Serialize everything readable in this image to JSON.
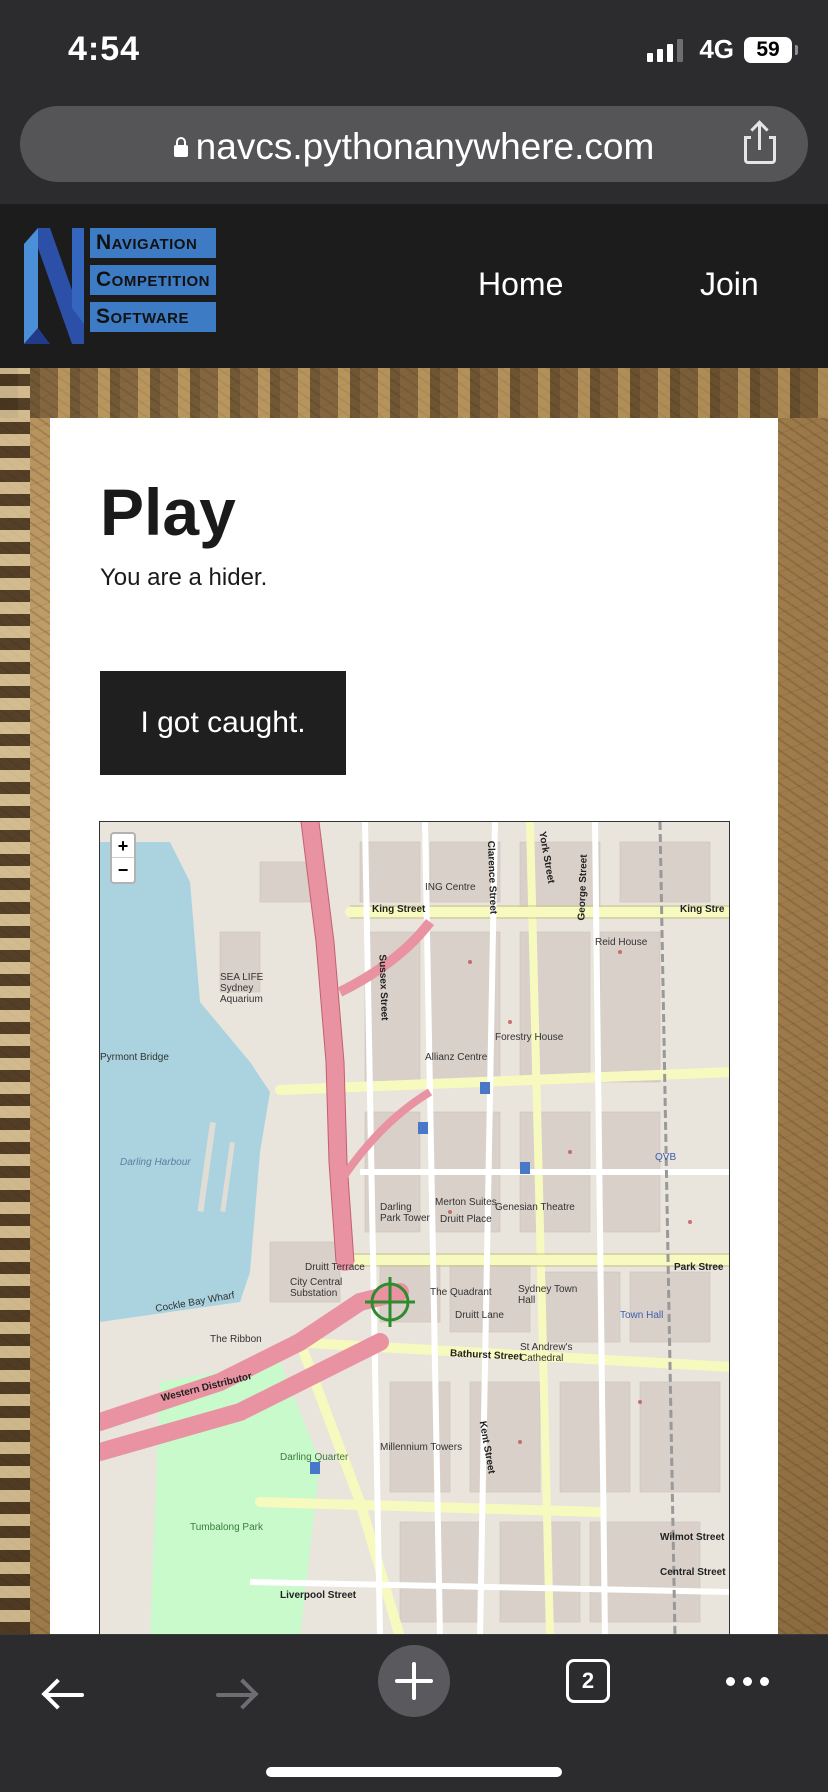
{
  "status": {
    "time": "4:54",
    "network": "4G",
    "battery": "59"
  },
  "browser": {
    "url": "navcs.pythonanywhere.com",
    "tab_count": "2"
  },
  "header": {
    "logo_lines": [
      "Navigation",
      "Competition",
      "Software"
    ],
    "nav": {
      "home": "Home",
      "join": "Join"
    }
  },
  "page": {
    "title": "Play",
    "role_text": "You are a hider.",
    "caught_button": "I got caught."
  },
  "map": {
    "zoom_in": "+",
    "zoom_out": "−",
    "labels": {
      "king_street": "King Street",
      "king_street_2": "King Stre",
      "bathurst_street": "Bathurst Street",
      "druitt_lane": "Druitt Lane",
      "druitt_place": "Druitt Place",
      "druitt_terrace": "Druitt Terrace",
      "park_street": "Park Stree",
      "liverpool_street": "Liverpool Street",
      "western_distributor": "Western Distributor",
      "the_ribbon": "The Ribbon",
      "the_quadrant": "The Quadrant",
      "city_central_substation": "City Central Substation",
      "darling_harbour": "Darling Harbour",
      "pyrmont_bridge": "Pyrmont Bridge",
      "sea_life": "SEA LIFE Sydney Aquarium",
      "sussex_street": "Sussex Street",
      "clarence_street": "Clarence Street",
      "york_street": "York Street",
      "kent_street": "Kent Street",
      "george_street": "George Street",
      "town_hall": "Town Hall",
      "sydney_town_hall": "Sydney Town Hall",
      "st_andrews": "St Andrew's Cathedral",
      "tumbalong_park": "Tumbalong Park",
      "darling_quarter": "Darling Quarter",
      "forestry_house": "Forestry House",
      "allianz_centre": "Allianz Centre",
      "merton_suites": "Merton Suites",
      "genesian_theatre": "Genesian Theatre",
      "darling_park_tower": "Darling Park Tower",
      "millennium_towers": "Millennium Towers",
      "wilmot_street": "Wilmot Street",
      "central_street": "Central Street",
      "cockle_bay_wharf": "Cockle Bay Wharf",
      "reid_house": "Reid House",
      "ing_centre": "ING Centre",
      "qvb": "QVB"
    }
  },
  "colors": {
    "header_bg": "#1c1c1c",
    "logo_blue": "#3d7cc4",
    "button_bg": "#1f1f1f",
    "water": "#aad3df",
    "major_road": "#e892a2",
    "secondary_road": "#f7fabf",
    "park": "#c8facc",
    "target_marker": "#2e8b2e"
  }
}
